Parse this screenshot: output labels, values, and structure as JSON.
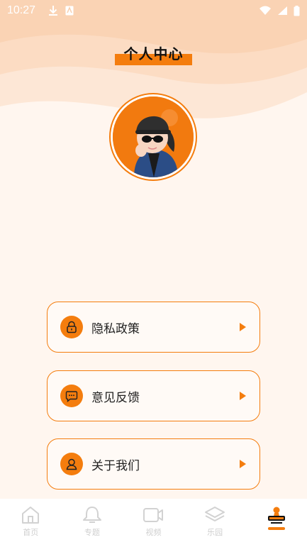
{
  "status_bar": {
    "time": "10:27",
    "left_icons": [
      "download-icon",
      "app-notification-icon"
    ],
    "right_icons": [
      "wifi-icon",
      "signal-icon",
      "battery-icon"
    ]
  },
  "header": {
    "title": "个人中心"
  },
  "profile": {
    "avatar_icon": "avatar-icon"
  },
  "menu": {
    "items": [
      {
        "label": "隐私政策",
        "icon": "lock-icon"
      },
      {
        "label": "意见反馈",
        "icon": "chat-bubble-icon"
      },
      {
        "label": "关于我们",
        "icon": "user-icon"
      }
    ]
  },
  "tab_bar": {
    "tabs": [
      {
        "label": "首页",
        "icon": "home-icon"
      },
      {
        "label": "专题",
        "icon": "bell-icon"
      },
      {
        "label": "视频",
        "icon": "video-icon"
      },
      {
        "label": "乐园",
        "icon": "layers-icon"
      },
      {
        "label": "",
        "icon": "profile-stamp-icon"
      }
    ],
    "active_index": 4
  },
  "colors": {
    "accent": "#f47d0e",
    "background": "#fff6ef",
    "header_bg": "#fde3cf",
    "inactive_tab": "#cfcfcf"
  }
}
